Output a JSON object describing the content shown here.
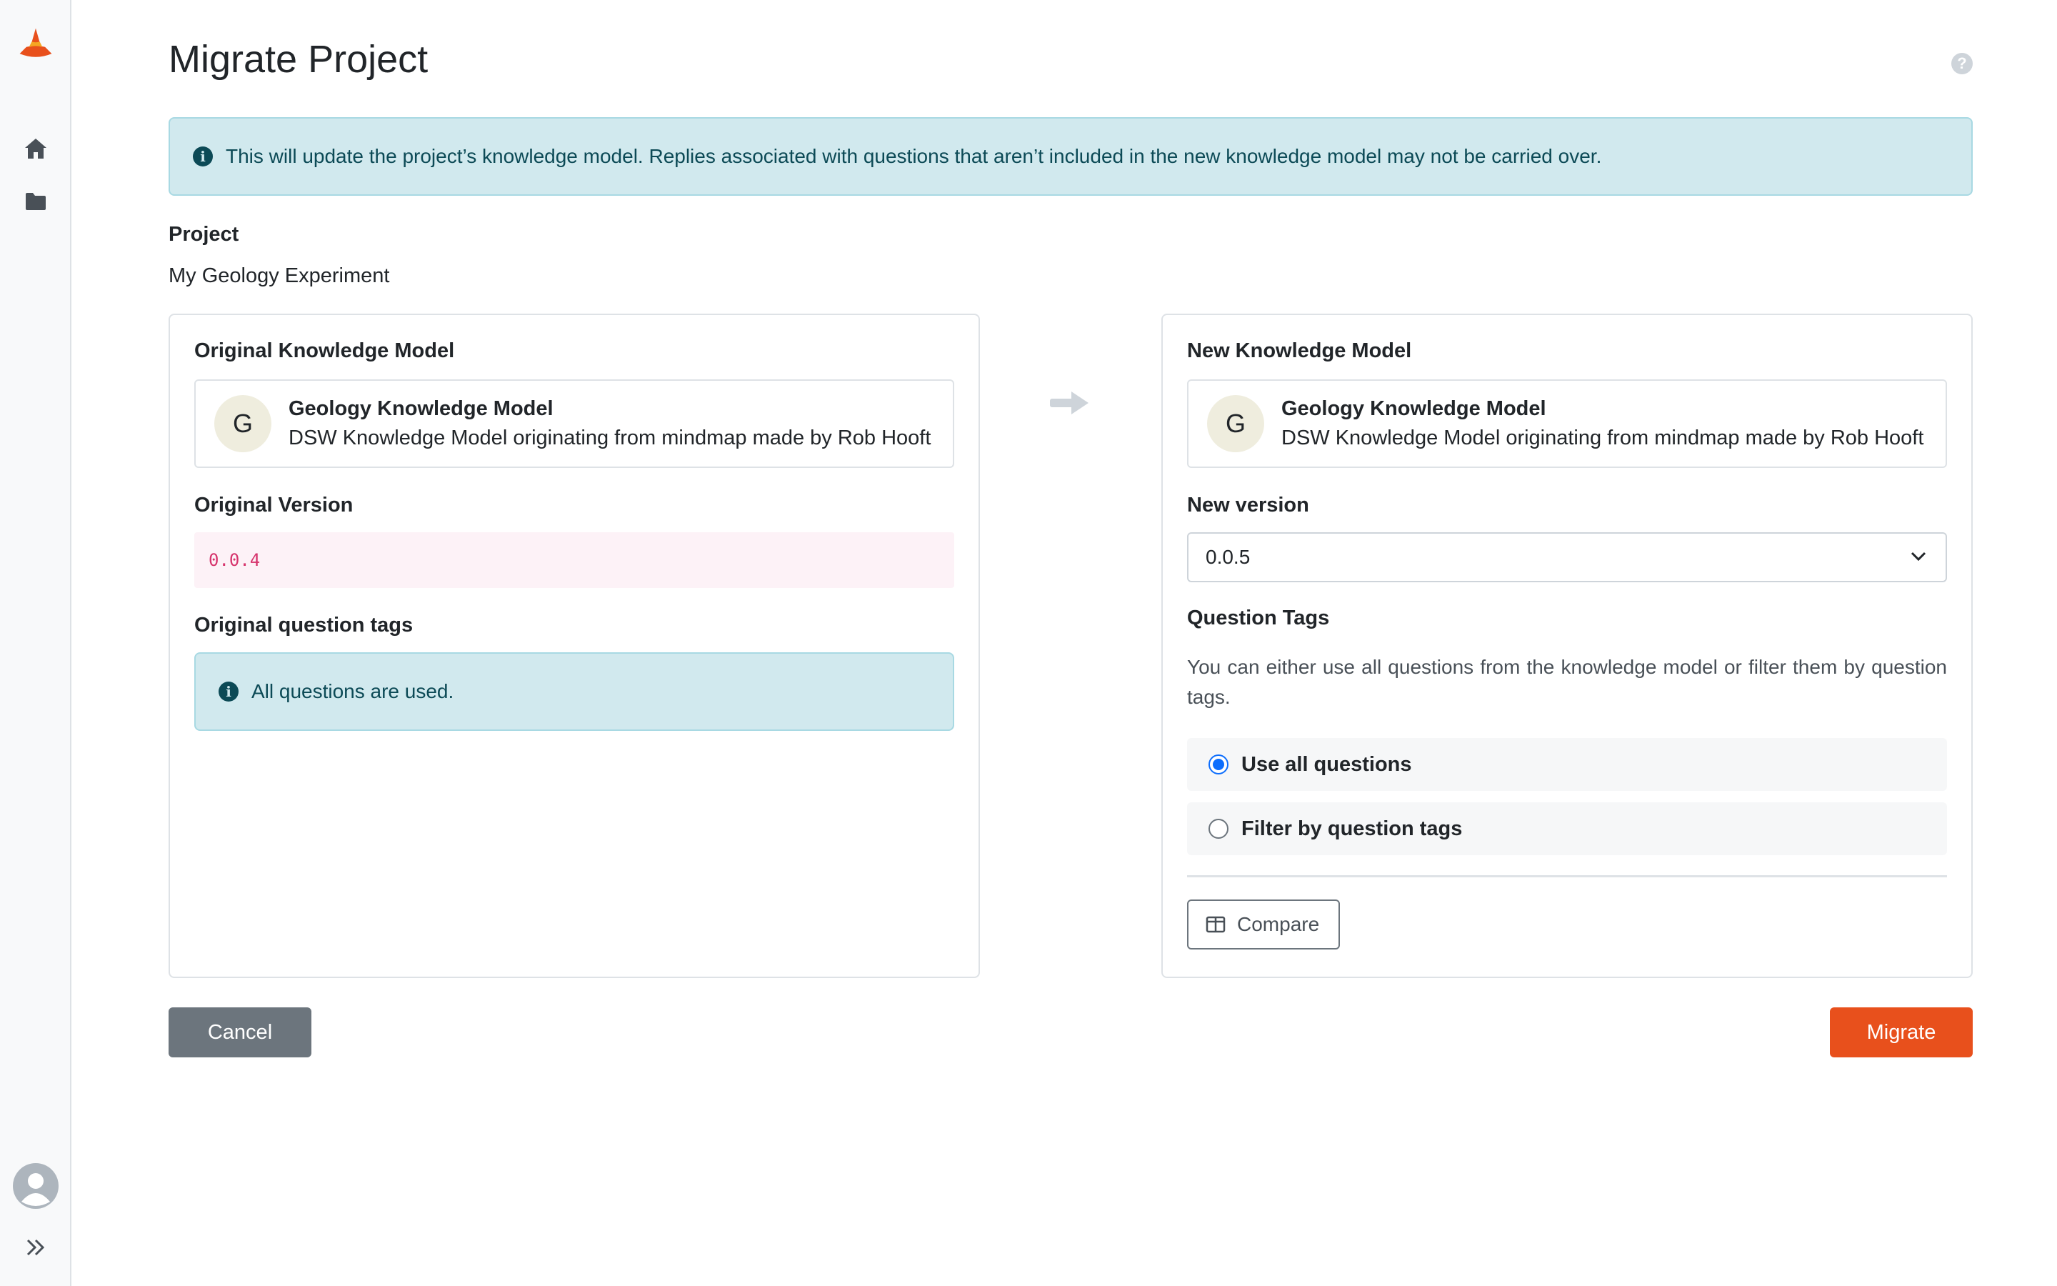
{
  "sidebar": {
    "logo_icon": "wizard-hat-logo",
    "items": [
      {
        "icon": "home-icon"
      },
      {
        "icon": "folder-icon"
      }
    ],
    "profile_icon": "avatar-icon",
    "expand_icon": "double-chevron-right-icon"
  },
  "header": {
    "title": "Migrate Project",
    "help_icon_text": "?"
  },
  "alert": {
    "text": "This will update the project’s knowledge model. Replies associated with questions that aren’t included in the new knowledge model may not be carried over."
  },
  "project": {
    "label": "Project",
    "name": "My Geology Experiment"
  },
  "original": {
    "heading": "Original Knowledge Model",
    "km": {
      "initial": "G",
      "name": "Geology Knowledge Model",
      "description": "DSW Knowledge Model originating from mindmap made by Rob Hooft"
    },
    "version_label": "Original Version",
    "version": "0.0.4",
    "tags_label": "Original question tags",
    "tags_info": "All questions are used."
  },
  "new": {
    "heading": "New Knowledge Model",
    "km": {
      "initial": "G",
      "name": "Geology Knowledge Model",
      "description": "DSW Knowledge Model originating from mindmap made by Rob Hooft"
    },
    "version_label": "New version",
    "version_selected": "0.0.5",
    "tags_label": "Question Tags",
    "tags_help": "You can either use all questions from the knowledge model or filter them by question tags.",
    "options": [
      {
        "label": "Use all questions",
        "checked": true
      },
      {
        "label": "Filter by question tags",
        "checked": false
      }
    ],
    "compare_label": "Compare"
  },
  "actions": {
    "cancel": "Cancel",
    "migrate": "Migrate"
  },
  "colors": {
    "accent": "#e8501c",
    "info_bg": "#d1e9ee",
    "info_text": "#0c4a56",
    "secondary": "#6c757d",
    "radio": "#0d6efd"
  }
}
